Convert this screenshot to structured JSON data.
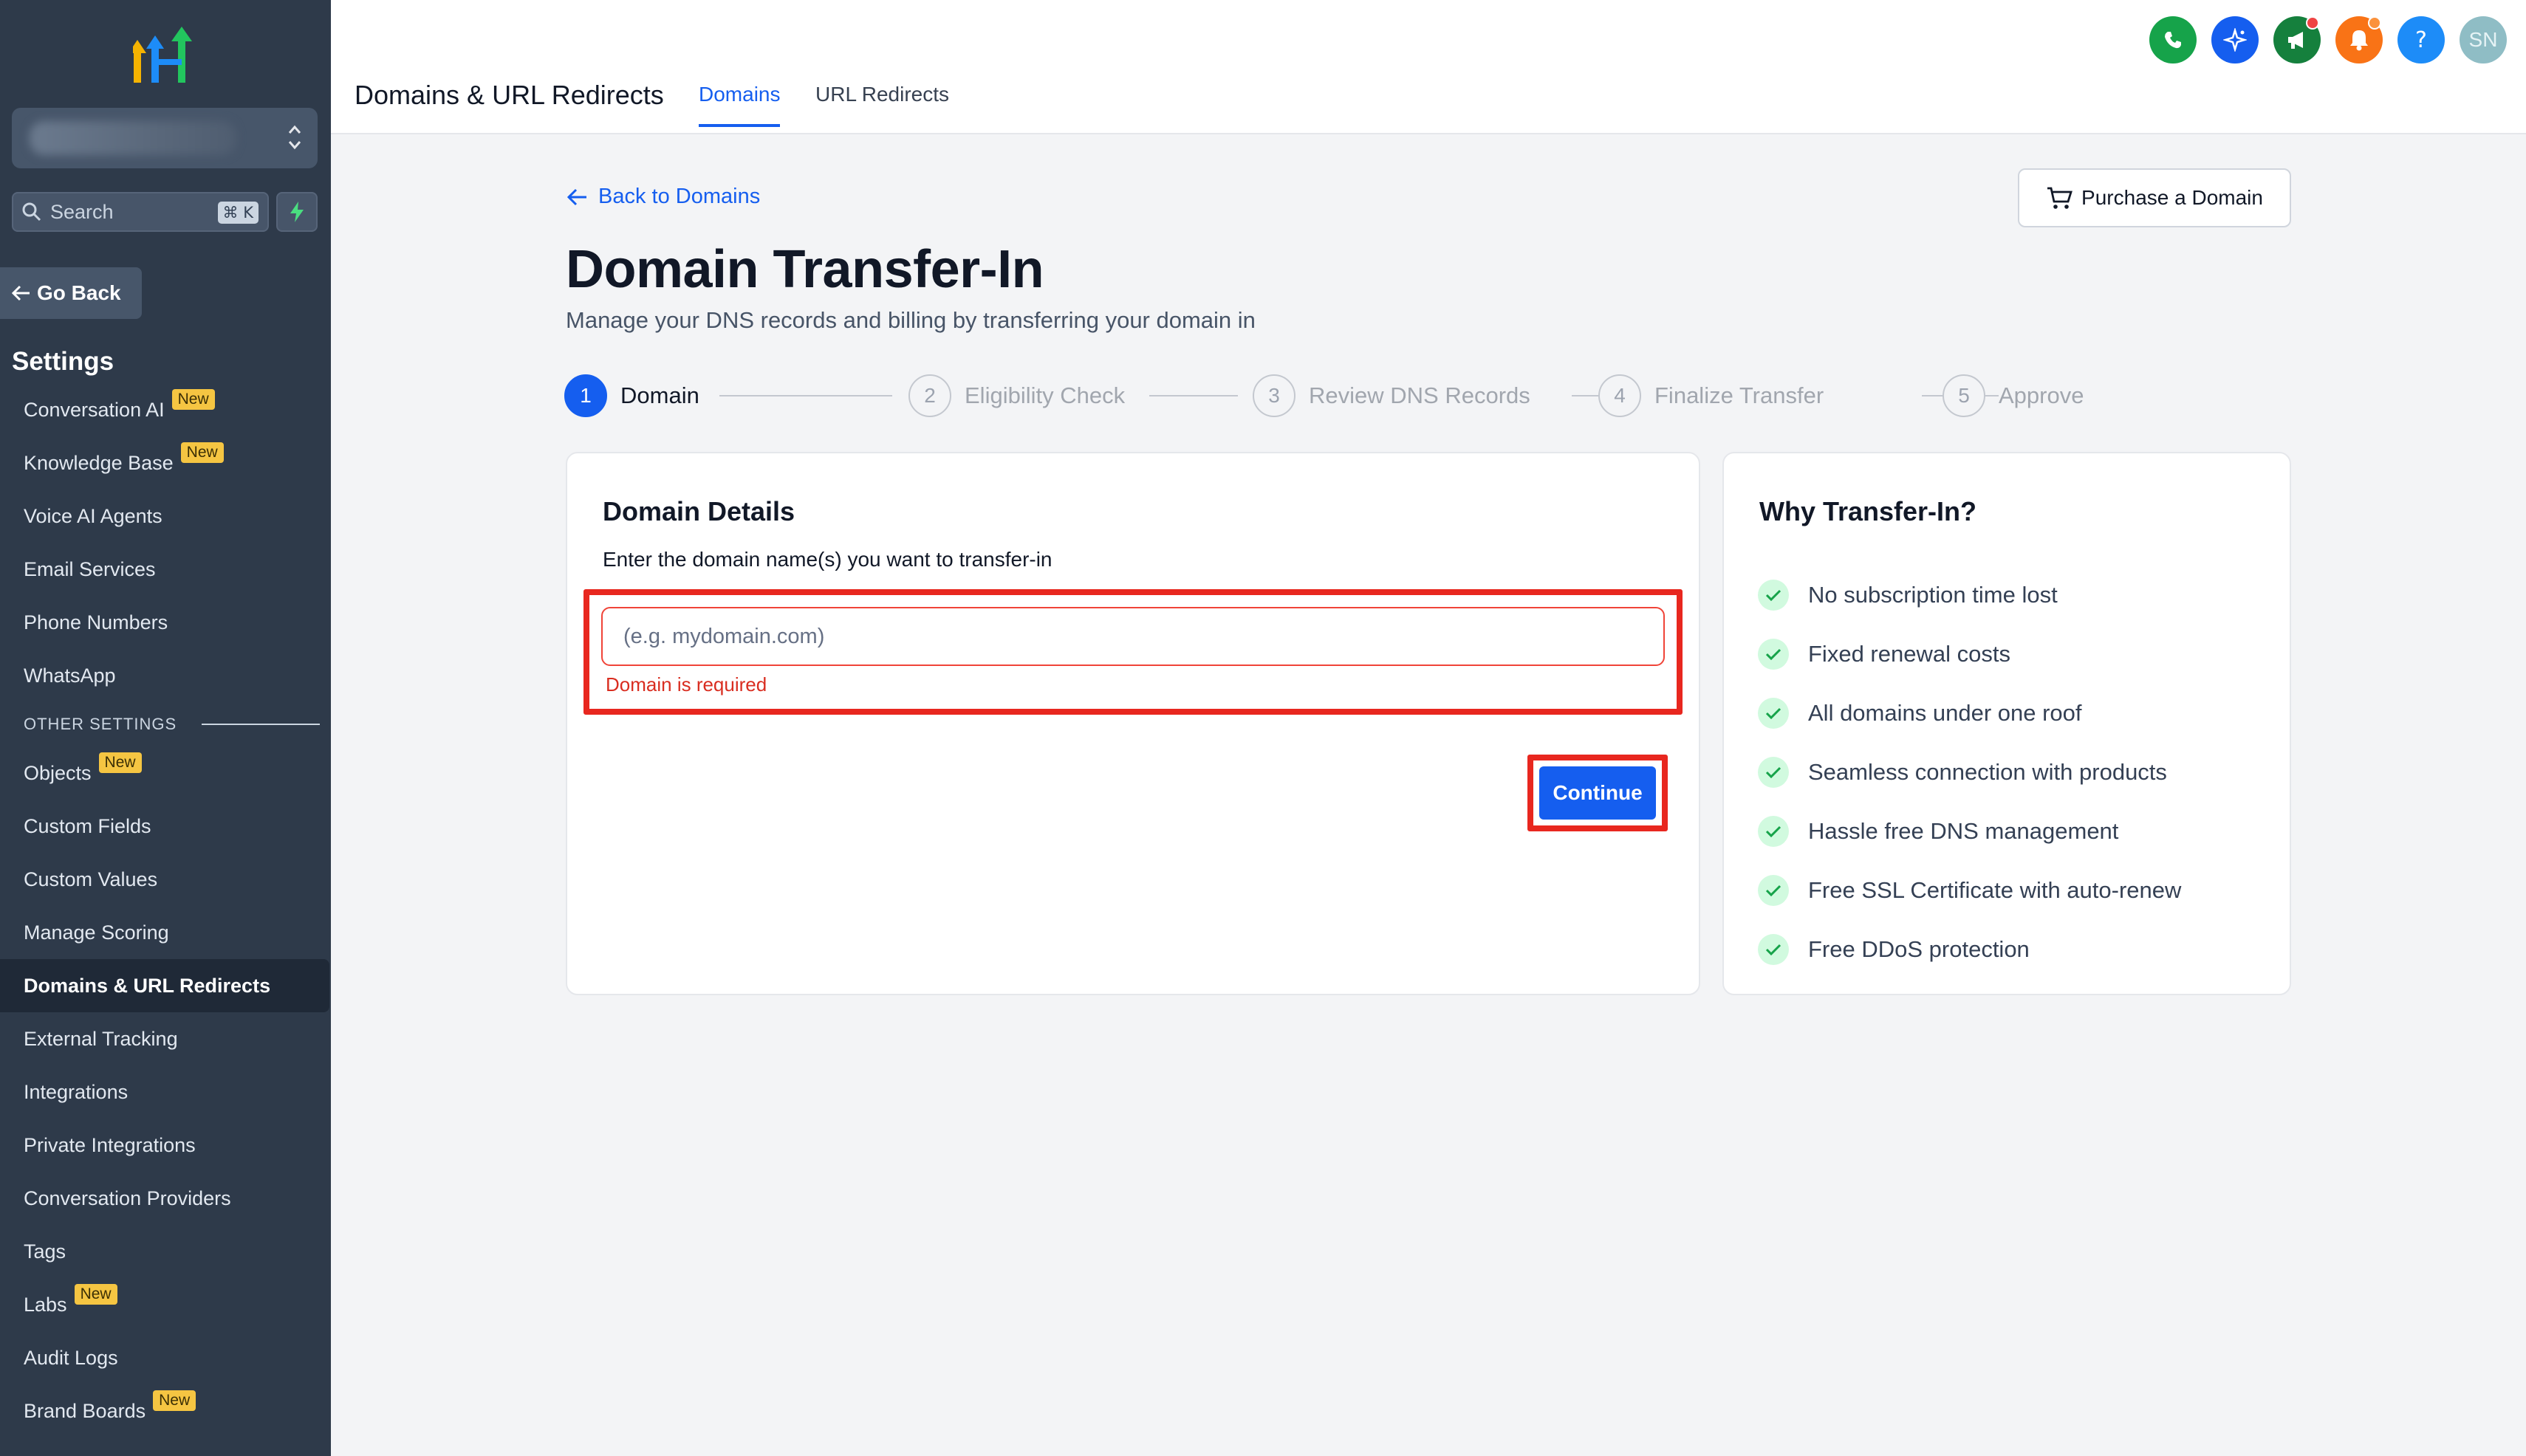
{
  "sidebar": {
    "search_placeholder": "Search",
    "search_shortcut": "⌘ K",
    "go_back_label": "Go Back",
    "settings_title": "Settings",
    "items": [
      {
        "label": "Conversation AI",
        "badge": "New"
      },
      {
        "label": "Knowledge Base",
        "badge": "New"
      },
      {
        "label": "Voice AI Agents"
      },
      {
        "label": "Email Services"
      },
      {
        "label": "Phone Numbers"
      },
      {
        "label": "WhatsApp"
      }
    ],
    "section_label": "OTHER SETTINGS",
    "other_items": [
      {
        "label": "Objects",
        "badge": "New"
      },
      {
        "label": "Custom Fields"
      },
      {
        "label": "Custom Values"
      },
      {
        "label": "Manage Scoring"
      },
      {
        "label": "Domains & URL Redirects",
        "active": true
      },
      {
        "label": "External Tracking"
      },
      {
        "label": "Integrations"
      },
      {
        "label": "Private Integrations"
      },
      {
        "label": "Conversation Providers"
      },
      {
        "label": "Tags"
      },
      {
        "label": "Labs",
        "badge": "New"
      },
      {
        "label": "Audit Logs"
      },
      {
        "label": "Brand Boards",
        "badge": "New"
      }
    ]
  },
  "header": {
    "title": "Domains & URL Redirects",
    "tabs": [
      {
        "label": "Domains",
        "active": true
      },
      {
        "label": "URL Redirects"
      }
    ],
    "icons": [
      {
        "name": "phone-icon",
        "color": "#16a34a"
      },
      {
        "name": "sparkle-icon",
        "color": "#155eef"
      },
      {
        "name": "megaphone-icon",
        "color": "#15803d",
        "dot": "#ef4444"
      },
      {
        "name": "bell-icon",
        "color": "#f97316",
        "dot": "#fb923c"
      },
      {
        "name": "help-icon",
        "color": "#1d8cf8"
      }
    ],
    "avatar_initials": "SN"
  },
  "main": {
    "back_link": "Back to Domains",
    "purchase_button": "Purchase a Domain",
    "title": "Domain Transfer-In",
    "subtitle": "Manage your DNS records and billing by transferring your domain in",
    "steps": [
      {
        "number": "1",
        "label": "Domain",
        "active": true
      },
      {
        "number": "2",
        "label": "Eligibility Check"
      },
      {
        "number": "3",
        "label": "Review DNS Records"
      },
      {
        "number": "4",
        "label": "Finalize Transfer"
      },
      {
        "number": "5",
        "label": "Approve"
      }
    ],
    "details": {
      "title": "Domain Details",
      "subtitle": "Enter the domain name(s) you want to transfer-in",
      "input_value": "",
      "input_placeholder": "(e.g. mydomain.com)",
      "error": "Domain is required",
      "continue_button": "Continue"
    },
    "why": {
      "title": "Why Transfer-In?",
      "items": [
        "No subscription time lost",
        "Fixed renewal costs",
        "All domains under one roof",
        "Seamless connection with products",
        "Hassle free DNS management",
        "Free SSL Certificate with auto-renew",
        "Free DDoS protection"
      ]
    }
  },
  "colors": {
    "accent": "#155eef",
    "sidebar_bg": "#2e3a4a",
    "error": "#d92d20",
    "highlight": "#e8271f"
  }
}
